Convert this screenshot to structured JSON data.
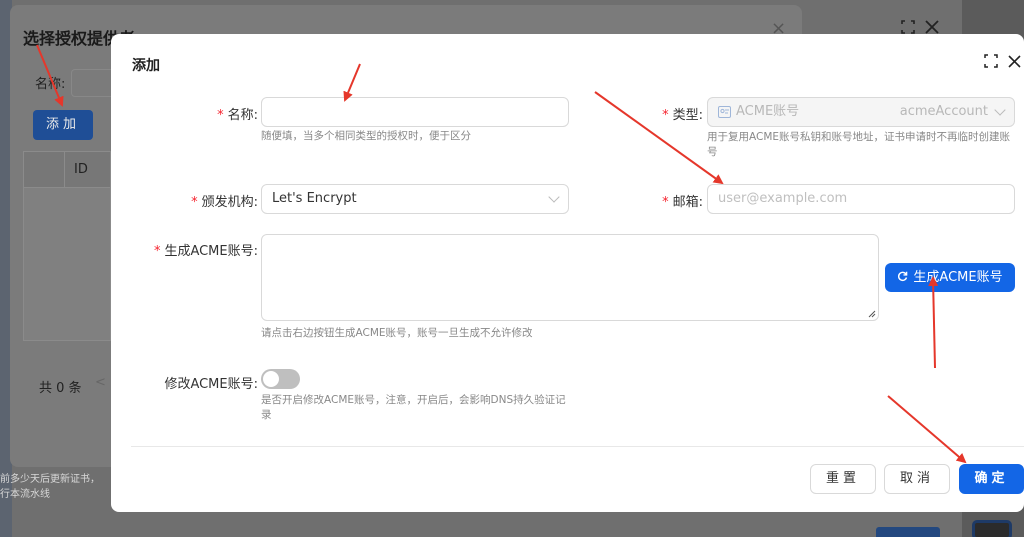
{
  "background": {
    "bottom_text_line1": "前多少天后更新证书，",
    "bottom_text_line2": "行本流水线"
  },
  "provider_dialog": {
    "title": "选择授权提供者",
    "name_label": "名称:",
    "add_button": "添加",
    "table_header_id": "ID",
    "total": "共 0 条",
    "prev": "<",
    "close": "×"
  },
  "add_dialog": {
    "title": "添加",
    "fields": {
      "name": {
        "label": "名称:",
        "value": "",
        "help": "随便填，当多个相同类型的授权时，便于区分"
      },
      "type": {
        "label": "类型:",
        "value": "ACME账号",
        "value_code": "acmeAccount",
        "help_line1": "用于复用ACME账号私钥和账号地址，证书申请时不再临时创建账",
        "help_line2": "号"
      },
      "issuer": {
        "label": "颁发机构:",
        "value": "Let's Encrypt"
      },
      "email": {
        "label": "邮箱:",
        "placeholder": "user@example.com"
      },
      "acme_account": {
        "label": "生成ACME账号:",
        "help": "请点击右边按钮生成ACME账号，账号一旦生成不允许修改",
        "generate_button": "生成ACME账号"
      },
      "modify_acme": {
        "label": "修改ACME账号:",
        "help_line1": "是否开启修改ACME账号，注意，开启后，会影响DNS持久验证记",
        "help_line2": "录",
        "enabled": false
      }
    },
    "buttons": {
      "reset": "重置",
      "cancel": "取消",
      "confirm": "确定"
    },
    "close": "×"
  },
  "colors": {
    "primary": "#1366e6",
    "required": "#f5222d",
    "arrow": "#e5372b"
  }
}
